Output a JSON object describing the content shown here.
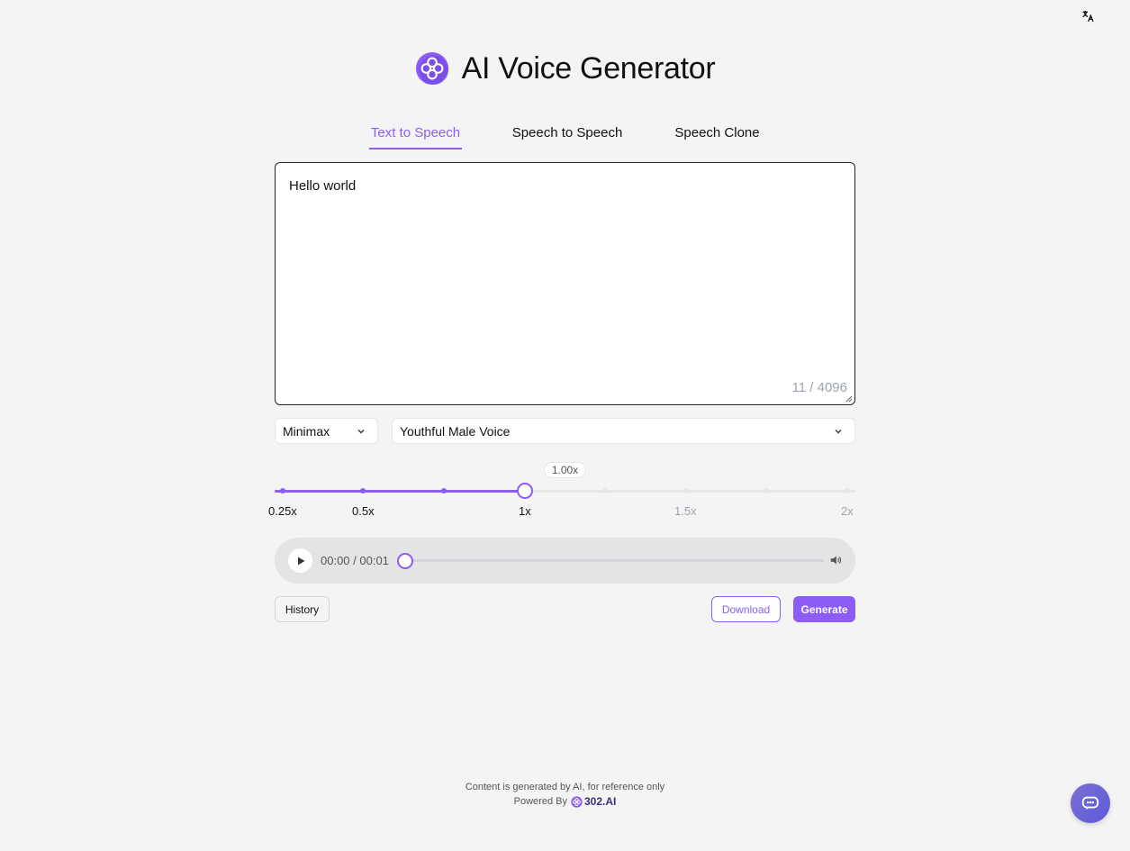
{
  "app": {
    "title": "AI Voice Generator"
  },
  "tabs": [
    {
      "label": "Text to Speech",
      "active": true
    },
    {
      "label": "Speech to Speech",
      "active": false
    },
    {
      "label": "Speech Clone",
      "active": false
    }
  ],
  "editor": {
    "value": "Hello world",
    "counter": "11 / 4096"
  },
  "selects": {
    "provider": "Minimax",
    "voice": "Youthful Male Voice"
  },
  "speed": {
    "current_label": "1.00x",
    "current_value": 1.0,
    "min": 0.25,
    "max": 2,
    "ticks": [
      "0.25x",
      "0.5x",
      "1x",
      "1.5x",
      "2x"
    ]
  },
  "player": {
    "time": "00:00 / 00:01",
    "progress": 0
  },
  "buttons": {
    "history": "History",
    "download": "Download",
    "generate": "Generate"
  },
  "footer": {
    "disclaimer": "Content is generated by AI, for reference only",
    "powered_by": "Powered By",
    "brand": "302.AI"
  },
  "colors": {
    "accent": "#8b5cf6",
    "background": "#f4f4f5"
  },
  "icons": [
    "translate-icon",
    "logo-icon",
    "chevron-down-icon",
    "play-icon",
    "volume-icon",
    "chat-icon"
  ]
}
